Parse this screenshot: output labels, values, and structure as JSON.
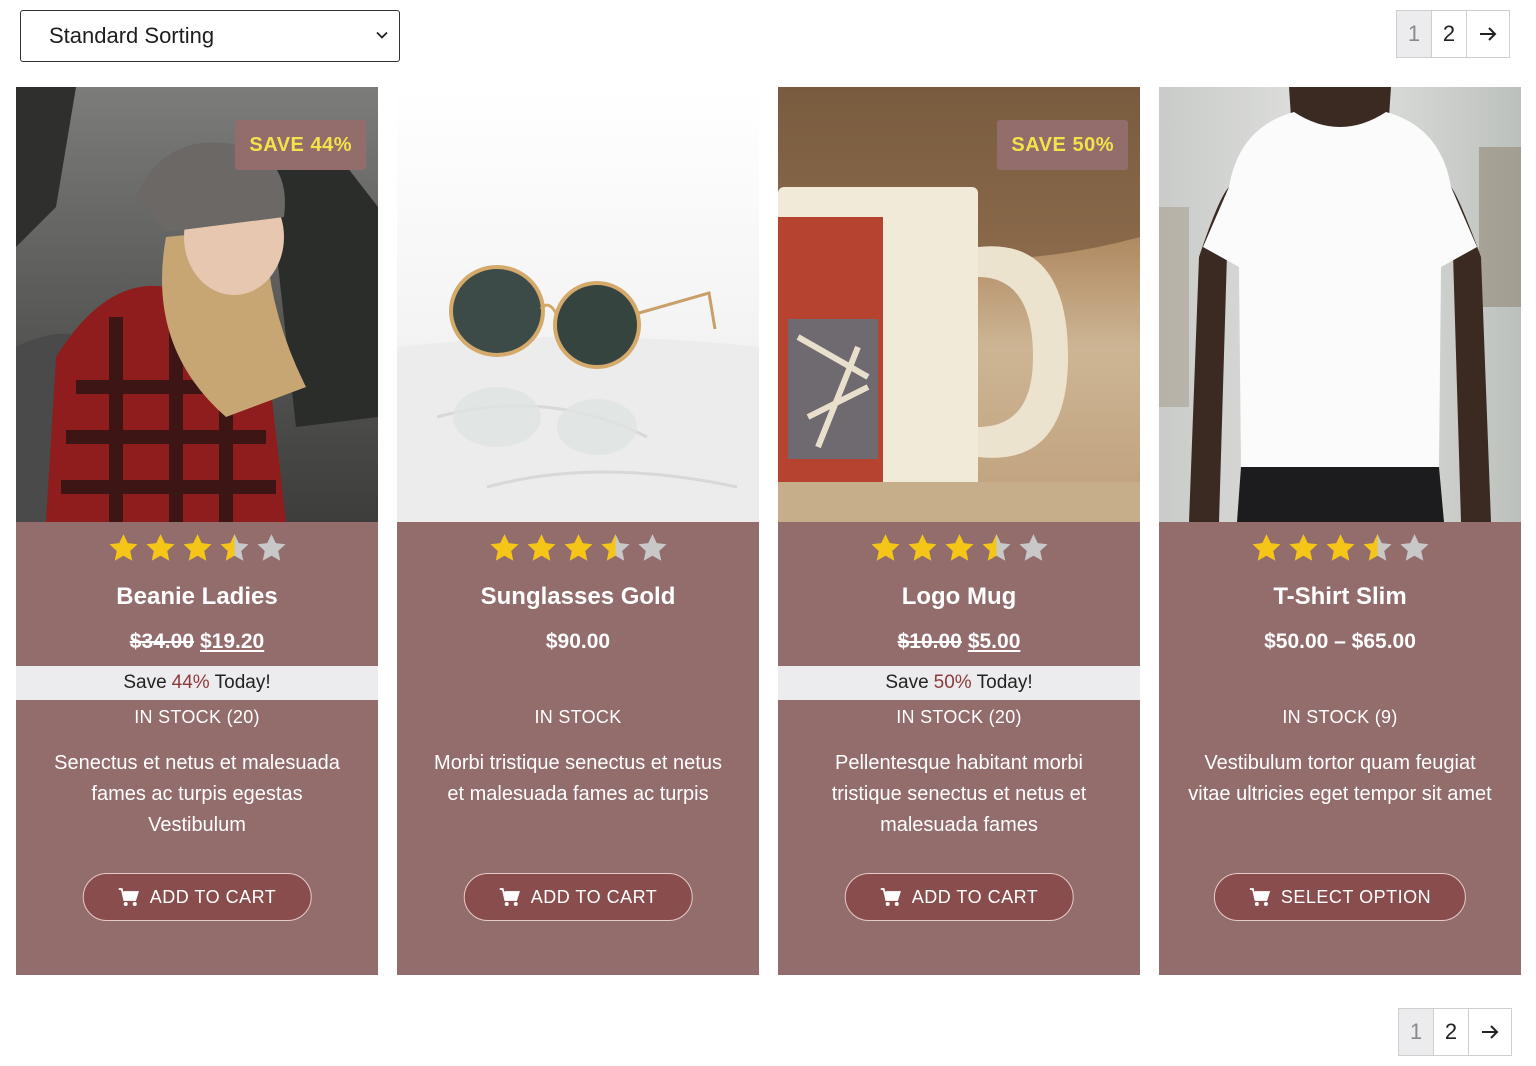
{
  "sorting": {
    "selected": "Standard Sorting"
  },
  "pagination": {
    "pages": [
      "1",
      "2"
    ],
    "current": "1",
    "next_icon": "arrow-right-icon"
  },
  "colors": {
    "card_bg": "#936c6c",
    "badge_text": "#f3e24a",
    "star_filled": "#f5c518",
    "star_empty": "#c8c8c8",
    "button_bg": "#8a4d4d"
  },
  "products": [
    {
      "name": "Beanie Ladies",
      "badge": "SAVE 44%",
      "rating": 3.5,
      "old_price": "$34.00",
      "price": "$19.20",
      "save_pre": "Save",
      "save_pct": "44%",
      "save_post": "Today!",
      "stock": "IN STOCK (20)",
      "description": "Senectus et netus et malesuada fames ac turpis egestas Vestibulum",
      "button": "ADD TO CART"
    },
    {
      "name": "Sunglasses Gold",
      "rating": 3.5,
      "price": "$90.00",
      "stock": "IN STOCK",
      "description": "Morbi tristique senectus et netus et malesuada fames ac turpis",
      "button": "ADD TO CART"
    },
    {
      "name": "Logo Mug",
      "badge": "SAVE 50%",
      "rating": 3.5,
      "old_price": "$10.00",
      "price": "$5.00",
      "save_pre": "Save",
      "save_pct": "50%",
      "save_post": "Today!",
      "stock": "IN STOCK (20)",
      "description": "Pellentesque habitant morbi tristique senectus et netus et malesuada fames",
      "button": "ADD TO CART"
    },
    {
      "name": "T-Shirt Slim",
      "rating": 3.5,
      "price": "$50.00 – $65.00",
      "stock": "IN STOCK (9)",
      "description": "Vestibulum tortor quam feugiat vitae ultricies eget tempor sit amet",
      "button": "SELECT OPTION"
    }
  ]
}
